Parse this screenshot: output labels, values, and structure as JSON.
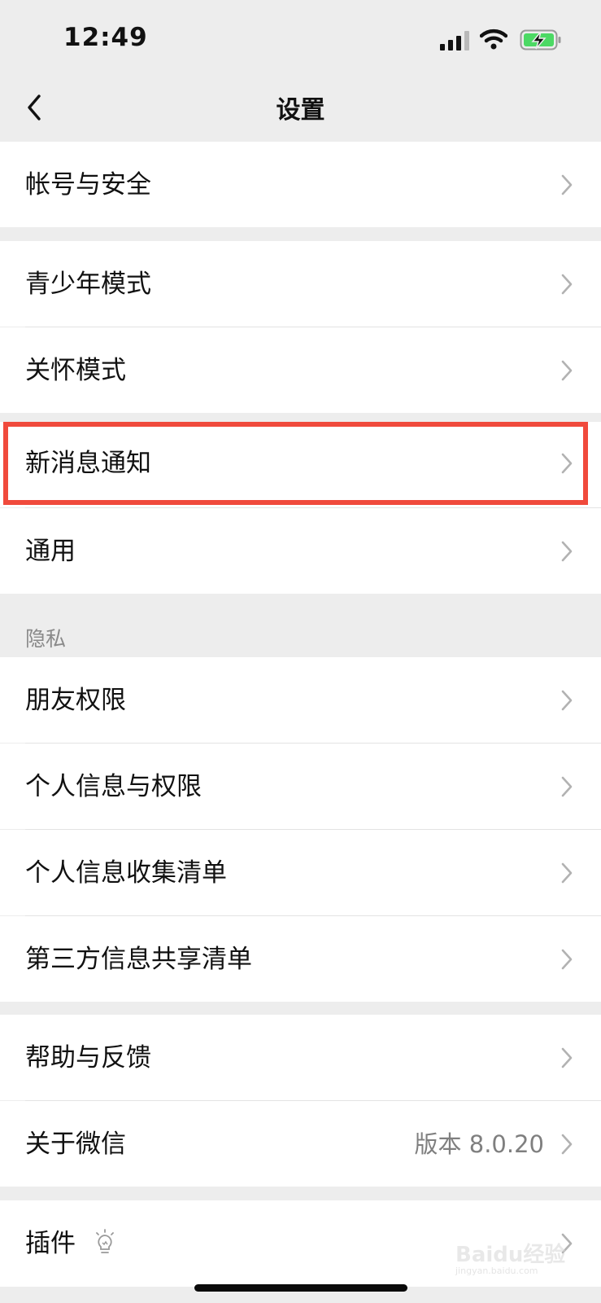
{
  "status_bar": {
    "time": "12:49",
    "signal_icon": "cellular-signal-icon",
    "wifi_icon": "wifi-icon",
    "battery_icon": "battery-charging-icon"
  },
  "nav": {
    "title": "设置",
    "back_icon": "back-chevron-icon"
  },
  "groups": [
    {
      "items": [
        {
          "label": "帐号与安全"
        }
      ]
    },
    {
      "items": [
        {
          "label": "青少年模式"
        },
        {
          "label": "关怀模式"
        }
      ]
    },
    {
      "items": [
        {
          "label": "新消息通知"
        },
        {
          "label": "通用"
        }
      ]
    },
    {
      "header": "隐私",
      "items": [
        {
          "label": "朋友权限"
        },
        {
          "label": "个人信息与权限"
        },
        {
          "label": "个人信息收集清单"
        },
        {
          "label": "第三方信息共享清单"
        }
      ]
    },
    {
      "items": [
        {
          "label": "帮助与反馈"
        },
        {
          "label": "关于微信",
          "value": "版本 8.0.20"
        }
      ]
    },
    {
      "items": [
        {
          "label": "插件",
          "icon": "lightbulb-icon"
        }
      ]
    }
  ],
  "watermark": {
    "text": "Baidu经验",
    "sub": "jingyan.baidu.com"
  },
  "colors": {
    "highlight": "#f04a3c",
    "background": "#ededed",
    "chevron": "#b2b2b2"
  }
}
